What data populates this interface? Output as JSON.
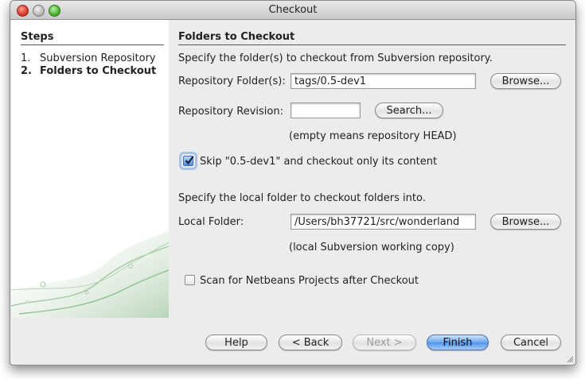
{
  "window": {
    "title": "Checkout"
  },
  "steps": {
    "title": "Steps",
    "items": [
      {
        "number": "1.",
        "label": "Subversion Repository",
        "current": false
      },
      {
        "number": "2.",
        "label": "Folders to Checkout",
        "current": true
      }
    ]
  },
  "panel": {
    "heading": "Folders to Checkout",
    "intro": "Specify the folder(s) to checkout from Subversion repository.",
    "repo_folder": {
      "label": "Repository Folder(s):",
      "value": "tags/0.5-dev1",
      "browse_label": "Browse..."
    },
    "repo_revision": {
      "label": "Repository Revision:",
      "value": "",
      "search_label": "Search...",
      "hint": "(empty means repository HEAD)"
    },
    "skip_option": {
      "label": "Skip \"0.5-dev1\" and checkout only its content",
      "checked": true
    },
    "local_intro": "Specify the local folder to checkout folders into.",
    "local_folder": {
      "label": "Local Folder:",
      "value": "/Users/bh37721/src/wonderland",
      "browse_label": "Browse...",
      "hint": "(local Subversion working copy)"
    },
    "scan_option": {
      "label": "Scan for Netbeans Projects after Checkout",
      "checked": false
    }
  },
  "buttons": {
    "help": "Help",
    "back": "< Back",
    "next": "Next >",
    "finish": "Finish",
    "cancel": "Cancel"
  },
  "colors": {
    "accent": "#4f93ea",
    "deco_green": "#7fb07a"
  }
}
